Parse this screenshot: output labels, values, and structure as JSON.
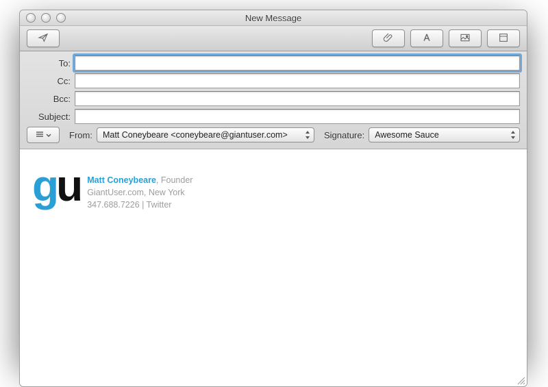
{
  "window": {
    "title": "New Message"
  },
  "fields": {
    "to_label": "To:",
    "cc_label": "Cc:",
    "bcc_label": "Bcc:",
    "subject_label": "Subject:",
    "to_value": "",
    "cc_value": "",
    "bcc_value": "",
    "subject_value": "",
    "from_label": "From:",
    "from_value": "Matt Coneybeare <coneybeare@giantuser.com>",
    "signature_label": "Signature:",
    "signature_value": "Awesome Sauce"
  },
  "signature": {
    "logo_g": "g",
    "logo_u": "u",
    "name": "Matt Coneybeare",
    "title_sep": ", ",
    "title": "Founder",
    "company": "GiantUser.com",
    "loc_sep": ", ",
    "location": "New York",
    "phone": "347.688.7226",
    "link_sep": " | ",
    "twitter": "Twitter"
  }
}
